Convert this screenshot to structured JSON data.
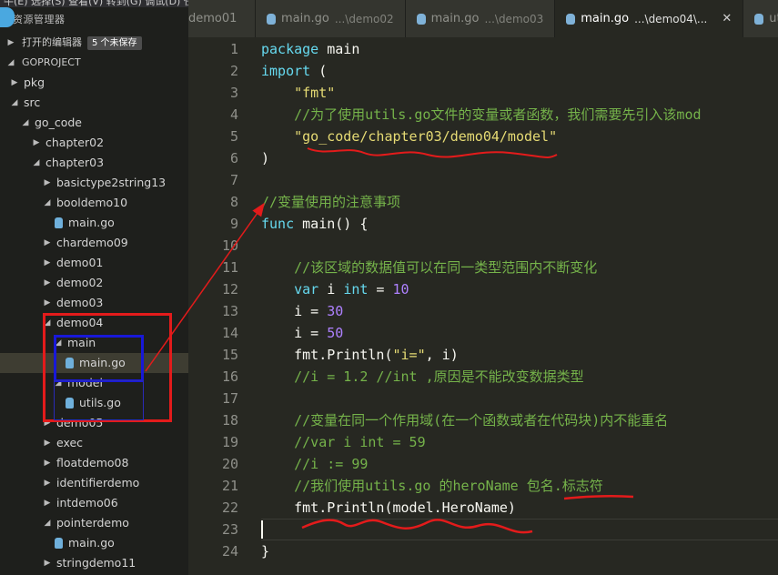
{
  "menubar": {
    "text": "牛(E)  选择(S)  查看(V)  转到(G)  调试(D)  任务(T)  帮助(H)"
  },
  "tabs": [
    {
      "name": "demo01",
      "path": ""
    },
    {
      "name": "main.go",
      "path": "...\\demo02"
    },
    {
      "name": "main.go",
      "path": "...\\demo03"
    },
    {
      "name": "main.go",
      "path": "...\\demo04\\...",
      "active": true
    },
    {
      "name": "utils",
      "path": ""
    }
  ],
  "sidebar": {
    "title": "资源管理器",
    "open_editors": "打开的编辑器",
    "unsaved_badge": "5 个未保存",
    "project": "GOPROJECT",
    "tree": [
      {
        "label": "pkg",
        "depth": 0,
        "state": "closed",
        "type": "folder"
      },
      {
        "label": "src",
        "depth": 0,
        "state": "open",
        "type": "folder"
      },
      {
        "label": "go_code",
        "depth": 1,
        "state": "open",
        "type": "folder"
      },
      {
        "label": "chapter02",
        "depth": 2,
        "state": "closed",
        "type": "folder"
      },
      {
        "label": "chapter03",
        "depth": 2,
        "state": "open",
        "type": "folder"
      },
      {
        "label": "basictype2string13",
        "depth": 3,
        "state": "closed",
        "type": "folder"
      },
      {
        "label": "booldemo10",
        "depth": 3,
        "state": "open",
        "type": "folder"
      },
      {
        "label": "main.go",
        "depth": 4,
        "type": "file"
      },
      {
        "label": "chardemo09",
        "depth": 3,
        "state": "closed",
        "type": "folder"
      },
      {
        "label": "demo01",
        "depth": 3,
        "state": "closed",
        "type": "folder"
      },
      {
        "label": "demo02",
        "depth": 3,
        "state": "closed",
        "type": "folder"
      },
      {
        "label": "demo03",
        "depth": 3,
        "state": "closed",
        "type": "folder"
      },
      {
        "label": "demo04",
        "depth": 3,
        "state": "open",
        "type": "folder"
      },
      {
        "label": "main",
        "depth": 4,
        "state": "open",
        "type": "folder"
      },
      {
        "label": "main.go",
        "depth": 5,
        "type": "file",
        "selected": true
      },
      {
        "label": "model",
        "depth": 4,
        "state": "open",
        "type": "folder"
      },
      {
        "label": "utils.go",
        "depth": 5,
        "type": "file"
      },
      {
        "label": "demo05",
        "depth": 3,
        "state": "closed",
        "type": "folder"
      },
      {
        "label": "exec",
        "depth": 3,
        "state": "closed",
        "type": "folder"
      },
      {
        "label": "floatdemo08",
        "depth": 3,
        "state": "closed",
        "type": "folder"
      },
      {
        "label": "identifierdemo",
        "depth": 3,
        "state": "closed",
        "type": "folder"
      },
      {
        "label": "intdemo06",
        "depth": 3,
        "state": "closed",
        "type": "folder"
      },
      {
        "label": "pointerdemo",
        "depth": 3,
        "state": "open",
        "type": "folder"
      },
      {
        "label": "main.go",
        "depth": 4,
        "type": "file"
      },
      {
        "label": "stringdemo11",
        "depth": 3,
        "state": "closed",
        "type": "folder"
      }
    ]
  },
  "editor": {
    "cursor_line": 23,
    "lines": [
      [
        [
          "kw",
          "package"
        ],
        [
          "pl",
          " main"
        ]
      ],
      [
        [
          "kw",
          "import"
        ],
        [
          "pl",
          " ("
        ]
      ],
      [
        [
          "pl",
          "    "
        ],
        [
          "str",
          "\"fmt\""
        ]
      ],
      [
        [
          "pl",
          "    "
        ],
        [
          "cm",
          "//为了使用utils.go文件的变量或者函数，我们需要先引入该mod"
        ]
      ],
      [
        [
          "pl",
          "    "
        ],
        [
          "str",
          "\"go_code/chapter03/demo04/model\""
        ]
      ],
      [
        [
          "pl",
          ")"
        ]
      ],
      [],
      [
        [
          "cm",
          "//变量使用的注意事项"
        ]
      ],
      [
        [
          "kw",
          "func"
        ],
        [
          "pl",
          " main() {"
        ]
      ],
      [],
      [
        [
          "pl",
          "    "
        ],
        [
          "cm",
          "//该区域的数据值可以在同一类型范围内不断变化"
        ]
      ],
      [
        [
          "pl",
          "    "
        ],
        [
          "kw",
          "var"
        ],
        [
          "pl",
          " i "
        ],
        [
          "kw",
          "int"
        ],
        [
          "pl",
          " = "
        ],
        [
          "num",
          "10"
        ]
      ],
      [
        [
          "pl",
          "    i = "
        ],
        [
          "num",
          "30"
        ]
      ],
      [
        [
          "pl",
          "    i = "
        ],
        [
          "num",
          "50"
        ]
      ],
      [
        [
          "pl",
          "    fmt.Println("
        ],
        [
          "str",
          "\"i=\""
        ],
        [
          "pl",
          ", i)"
        ]
      ],
      [
        [
          "pl",
          "    "
        ],
        [
          "cm",
          "//i = 1.2 //int ,原因是不能改变数据类型"
        ]
      ],
      [],
      [
        [
          "pl",
          "    "
        ],
        [
          "cm",
          "//变量在同一个作用域(在一个函数或者在代码块)内不能重名"
        ]
      ],
      [
        [
          "pl",
          "    "
        ],
        [
          "cm",
          "//var i int = 59"
        ]
      ],
      [
        [
          "pl",
          "    "
        ],
        [
          "cm",
          "//i := 99"
        ]
      ],
      [
        [
          "pl",
          "    "
        ],
        [
          "cm",
          "//我们使用utils.go 的heroName 包名.标志符"
        ]
      ],
      [
        [
          "pl",
          "    fmt.Println(model.HeroName)"
        ]
      ],
      [
        [
          "pl",
          "    "
        ]
      ],
      [
        [
          "pl",
          "}"
        ]
      ]
    ]
  },
  "colors": {
    "annotation_red": "#e31b1b",
    "annotation_blue": "#1818d8",
    "keyword": "#66d9ef",
    "string": "#e6db74",
    "comment": "#75b34a",
    "number": "#ae81ff"
  }
}
